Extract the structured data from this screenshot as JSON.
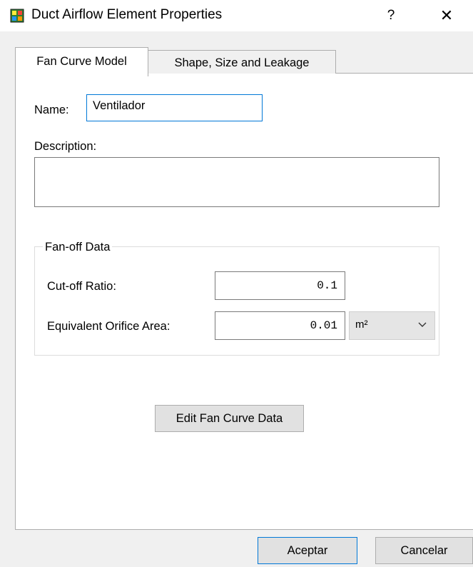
{
  "window": {
    "title": "Duct Airflow Element Properties",
    "help_label": "?",
    "close_label": "✕"
  },
  "tabs": [
    {
      "label": "Fan Curve Model",
      "active": true
    },
    {
      "label": "Shape, Size and Leakage",
      "active": false
    }
  ],
  "form": {
    "name_label": "Name:",
    "name_value": "Ventilador",
    "description_label": "Description:",
    "description_value": ""
  },
  "fan_off": {
    "group_title": "Fan-off Data",
    "cutoff_label": "Cut-off Ratio:",
    "cutoff_value": "0.1",
    "orifice_label": "Equivalent Orifice Area:",
    "orifice_value": "0.01",
    "unit_value": "m²"
  },
  "buttons": {
    "edit_curve": "Edit Fan Curve Data",
    "ok": "Aceptar",
    "cancel": "Cancelar"
  },
  "colors": {
    "accent": "#0078d7"
  },
  "icons": {
    "app": "app-icon",
    "dropdown": "chevron-down-icon"
  }
}
